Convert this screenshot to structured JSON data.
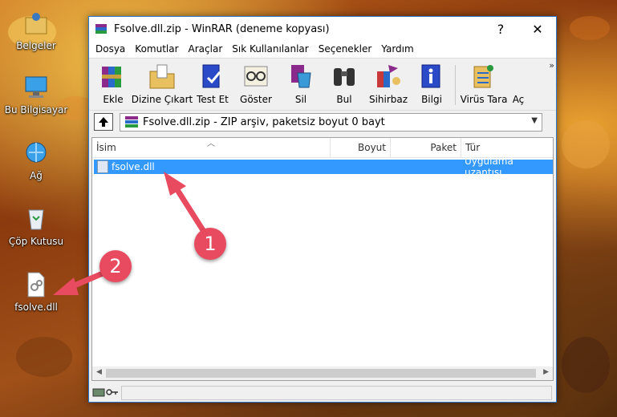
{
  "desktop": {
    "icons": [
      {
        "label": "Belgeler",
        "icon": "user-folder-icon"
      },
      {
        "label": "Bu Bilgisayar",
        "icon": "computer-icon"
      },
      {
        "label": "Ağ",
        "icon": "network-icon"
      },
      {
        "label": "Çöp Kutusu",
        "icon": "recycle-bin-icon"
      },
      {
        "label": "fsolve.dll",
        "icon": "dll-file-icon"
      }
    ]
  },
  "window": {
    "title": "Fsolve.dll.zip - WinRAR (deneme kopyası)",
    "help": "?",
    "close": "✕",
    "menu": [
      "Dosya",
      "Komutlar",
      "Araçlar",
      "Sık Kullanılanlar",
      "Seçenekler",
      "Yardım"
    ],
    "toolbar": [
      {
        "label": "Ekle",
        "icon": "books-add-icon"
      },
      {
        "label": "Dizine Çıkart",
        "icon": "extract-folder-icon"
      },
      {
        "label": "Test Et",
        "icon": "test-book-icon"
      },
      {
        "label": "Göster",
        "icon": "view-glasses-icon"
      },
      {
        "label": "Sil",
        "icon": "delete-icon"
      },
      {
        "label": "Bul",
        "icon": "binoculars-icon"
      },
      {
        "label": "Sihirbaz",
        "icon": "wizard-icon"
      },
      {
        "label": "Bilgi",
        "icon": "info-icon"
      },
      {
        "label": "Virüs Tara",
        "icon": "virus-scan-icon"
      },
      {
        "label": "Aç",
        "icon": "open-icon"
      }
    ],
    "toolbar_more": "»",
    "path": "Fsolve.dll.zip - ZIP arşiv, paketsiz boyut 0 bayt",
    "columns": [
      "İsim",
      "Boyut",
      "Paket",
      "Tür"
    ],
    "files": [
      {
        "name": "fsolve.dll",
        "size": "",
        "packed": "",
        "type": "Uygulama uzantısı"
      }
    ]
  },
  "annotations": {
    "badge1": "1",
    "badge2": "2"
  },
  "colors": {
    "selection": "#3399ff",
    "badge": "#e84a5f",
    "window_border": "#2b78c8"
  }
}
